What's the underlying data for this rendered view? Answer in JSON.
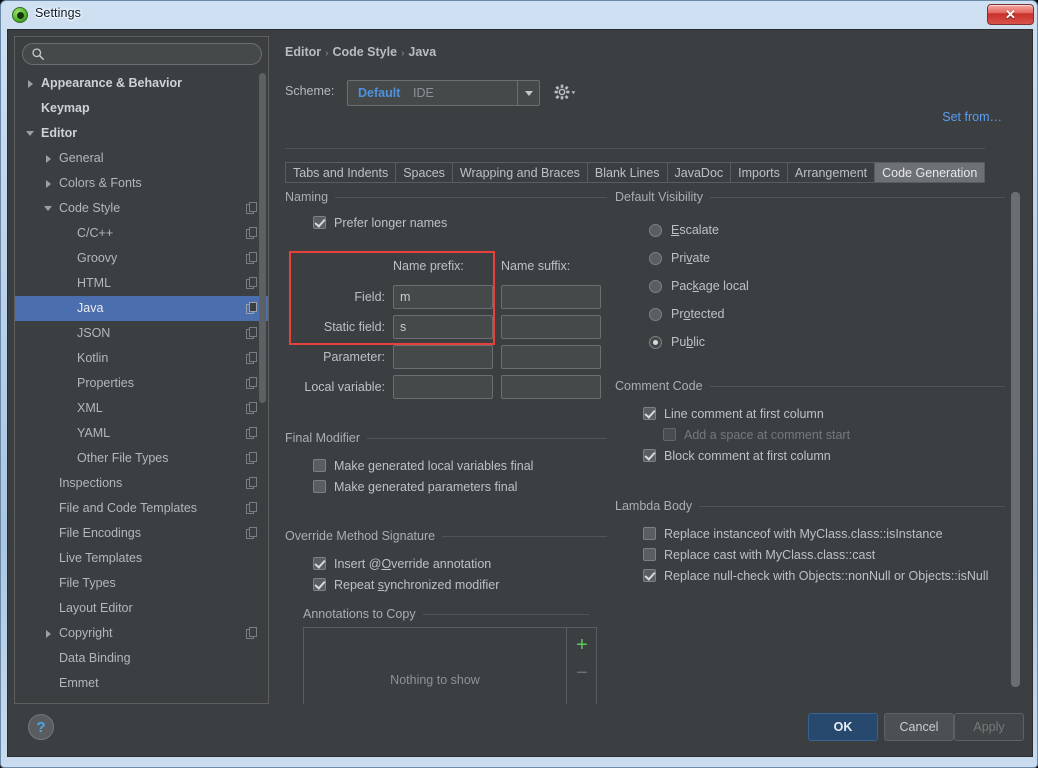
{
  "window": {
    "title": "Settings",
    "icon": "app-icon",
    "close_label": "✕"
  },
  "sidebar": {
    "search": {
      "value": "",
      "placeholder": "",
      "icon": "search-icon"
    },
    "items": [
      {
        "label": "Appearance & Behavior",
        "level": 0,
        "toggle": "closed",
        "bold": true,
        "copy": false,
        "selected": false
      },
      {
        "label": "Keymap",
        "level": 0,
        "toggle": "none",
        "bold": true,
        "copy": false,
        "selected": false
      },
      {
        "label": "Editor",
        "level": 0,
        "toggle": "open",
        "bold": true,
        "copy": false,
        "selected": false
      },
      {
        "label": "General",
        "level": 1,
        "toggle": "closed",
        "bold": false,
        "copy": false,
        "selected": false
      },
      {
        "label": "Colors & Fonts",
        "level": 1,
        "toggle": "closed",
        "bold": false,
        "copy": false,
        "selected": false
      },
      {
        "label": "Code Style",
        "level": 1,
        "toggle": "open",
        "bold": false,
        "copy": true,
        "selected": false
      },
      {
        "label": "C/C++",
        "level": 2,
        "toggle": "none",
        "bold": false,
        "copy": true,
        "selected": false
      },
      {
        "label": "Groovy",
        "level": 2,
        "toggle": "none",
        "bold": false,
        "copy": true,
        "selected": false
      },
      {
        "label": "HTML",
        "level": 2,
        "toggle": "none",
        "bold": false,
        "copy": true,
        "selected": false
      },
      {
        "label": "Java",
        "level": 2,
        "toggle": "none",
        "bold": false,
        "copy": true,
        "selected": true
      },
      {
        "label": "JSON",
        "level": 2,
        "toggle": "none",
        "bold": false,
        "copy": true,
        "selected": false
      },
      {
        "label": "Kotlin",
        "level": 2,
        "toggle": "none",
        "bold": false,
        "copy": true,
        "selected": false
      },
      {
        "label": "Properties",
        "level": 2,
        "toggle": "none",
        "bold": false,
        "copy": true,
        "selected": false
      },
      {
        "label": "XML",
        "level": 2,
        "toggle": "none",
        "bold": false,
        "copy": true,
        "selected": false
      },
      {
        "label": "YAML",
        "level": 2,
        "toggle": "none",
        "bold": false,
        "copy": true,
        "selected": false
      },
      {
        "label": "Other File Types",
        "level": 2,
        "toggle": "none",
        "bold": false,
        "copy": true,
        "selected": false
      },
      {
        "label": "Inspections",
        "level": 1,
        "toggle": "none",
        "bold": false,
        "copy": true,
        "selected": false
      },
      {
        "label": "File and Code Templates",
        "level": 1,
        "toggle": "none",
        "bold": false,
        "copy": true,
        "selected": false
      },
      {
        "label": "File Encodings",
        "level": 1,
        "toggle": "none",
        "bold": false,
        "copy": true,
        "selected": false
      },
      {
        "label": "Live Templates",
        "level": 1,
        "toggle": "none",
        "bold": false,
        "copy": false,
        "selected": false
      },
      {
        "label": "File Types",
        "level": 1,
        "toggle": "none",
        "bold": false,
        "copy": false,
        "selected": false
      },
      {
        "label": "Layout Editor",
        "level": 1,
        "toggle": "none",
        "bold": false,
        "copy": false,
        "selected": false
      },
      {
        "label": "Copyright",
        "level": 1,
        "toggle": "closed",
        "bold": false,
        "copy": true,
        "selected": false
      },
      {
        "label": "Data Binding",
        "level": 1,
        "toggle": "none",
        "bold": false,
        "copy": false,
        "selected": false
      },
      {
        "label": "Emmet",
        "level": 1,
        "toggle": "none",
        "bold": false,
        "copy": false,
        "selected": false
      }
    ]
  },
  "main": {
    "breadcrumb": {
      "part1": "Editor",
      "part2": "Code Style",
      "part3": "Java",
      "separator": "›"
    },
    "scheme": {
      "label": "Scheme:",
      "value": "Default",
      "value_suffix": "IDE",
      "gear_icon": "gear-icon",
      "dropdown_icon": "chevron-down-icon"
    },
    "set_from_link": "Set from…",
    "tabs": [
      {
        "label": "Tabs and Indents",
        "active": false
      },
      {
        "label": "Spaces",
        "active": false
      },
      {
        "label": "Wrapping and Braces",
        "active": false
      },
      {
        "label": "Blank Lines",
        "active": false
      },
      {
        "label": "JavaDoc",
        "active": false
      },
      {
        "label": "Imports",
        "active": false
      },
      {
        "label": "Arrangement",
        "active": false
      },
      {
        "label": "Code Generation",
        "active": true
      }
    ],
    "naming": {
      "group_title": "Naming",
      "prefer_longer_names": {
        "label": "Prefer longer names",
        "checked": true
      },
      "col_prefix": "Name prefix:",
      "col_suffix": "Name suffix:",
      "rows": [
        {
          "label": "Field:",
          "prefix": "m",
          "suffix": ""
        },
        {
          "label": "Static field:",
          "prefix": "s",
          "suffix": ""
        },
        {
          "label": "Parameter:",
          "prefix": "",
          "suffix": ""
        },
        {
          "label": "Local variable:",
          "prefix": "",
          "suffix": ""
        }
      ],
      "highlight_color": "#e8413a"
    },
    "default_visibility": {
      "group_title": "Default Visibility",
      "options": [
        {
          "label": "Escalate",
          "mnemonic": "E",
          "selected": false
        },
        {
          "label": "Private",
          "mnemonic": "v",
          "selected": false
        },
        {
          "label": "Package local",
          "mnemonic": "k",
          "selected": false
        },
        {
          "label": "Protected",
          "mnemonic": "o",
          "selected": false
        },
        {
          "label": "Public",
          "mnemonic": "b",
          "selected": true
        }
      ]
    },
    "final_modifier": {
      "group_title": "Final Modifier",
      "items": [
        {
          "label": "Make generated local variables final",
          "checked": false,
          "disabled": false
        },
        {
          "label": "Make generated parameters final",
          "checked": false,
          "disabled": false
        }
      ]
    },
    "comment_code": {
      "group_title": "Comment Code",
      "items": [
        {
          "label": "Line comment at first column",
          "checked": true,
          "disabled": false,
          "indent": false
        },
        {
          "label": "Add a space at comment start",
          "checked": false,
          "disabled": true,
          "indent": true
        },
        {
          "label": "Block comment at first column",
          "checked": true,
          "disabled": false,
          "indent": false
        }
      ]
    },
    "override_method_signature": {
      "group_title": "Override Method Signature",
      "items": [
        {
          "label": "Insert @Override annotation",
          "mnemonic": "O",
          "checked": true
        },
        {
          "label": "Repeat synchronized modifier",
          "mnemonic": "s",
          "checked": true
        }
      ]
    },
    "lambda_body": {
      "group_title": "Lambda Body",
      "items": [
        {
          "label": "Replace instanceof with MyClass.class::isInstance",
          "checked": false
        },
        {
          "label": "Replace cast with MyClass.class::cast",
          "checked": false
        },
        {
          "label": "Replace null-check with Objects::nonNull or Objects::isNull",
          "checked": true
        }
      ]
    },
    "annotations_to_copy": {
      "group_title": "Annotations to Copy",
      "empty_text": "Nothing to show",
      "add_label": "+",
      "remove_label": "−"
    }
  },
  "footer": {
    "help_label": "?",
    "ok_label": "OK",
    "cancel_label": "Cancel",
    "apply_label": "Apply"
  }
}
